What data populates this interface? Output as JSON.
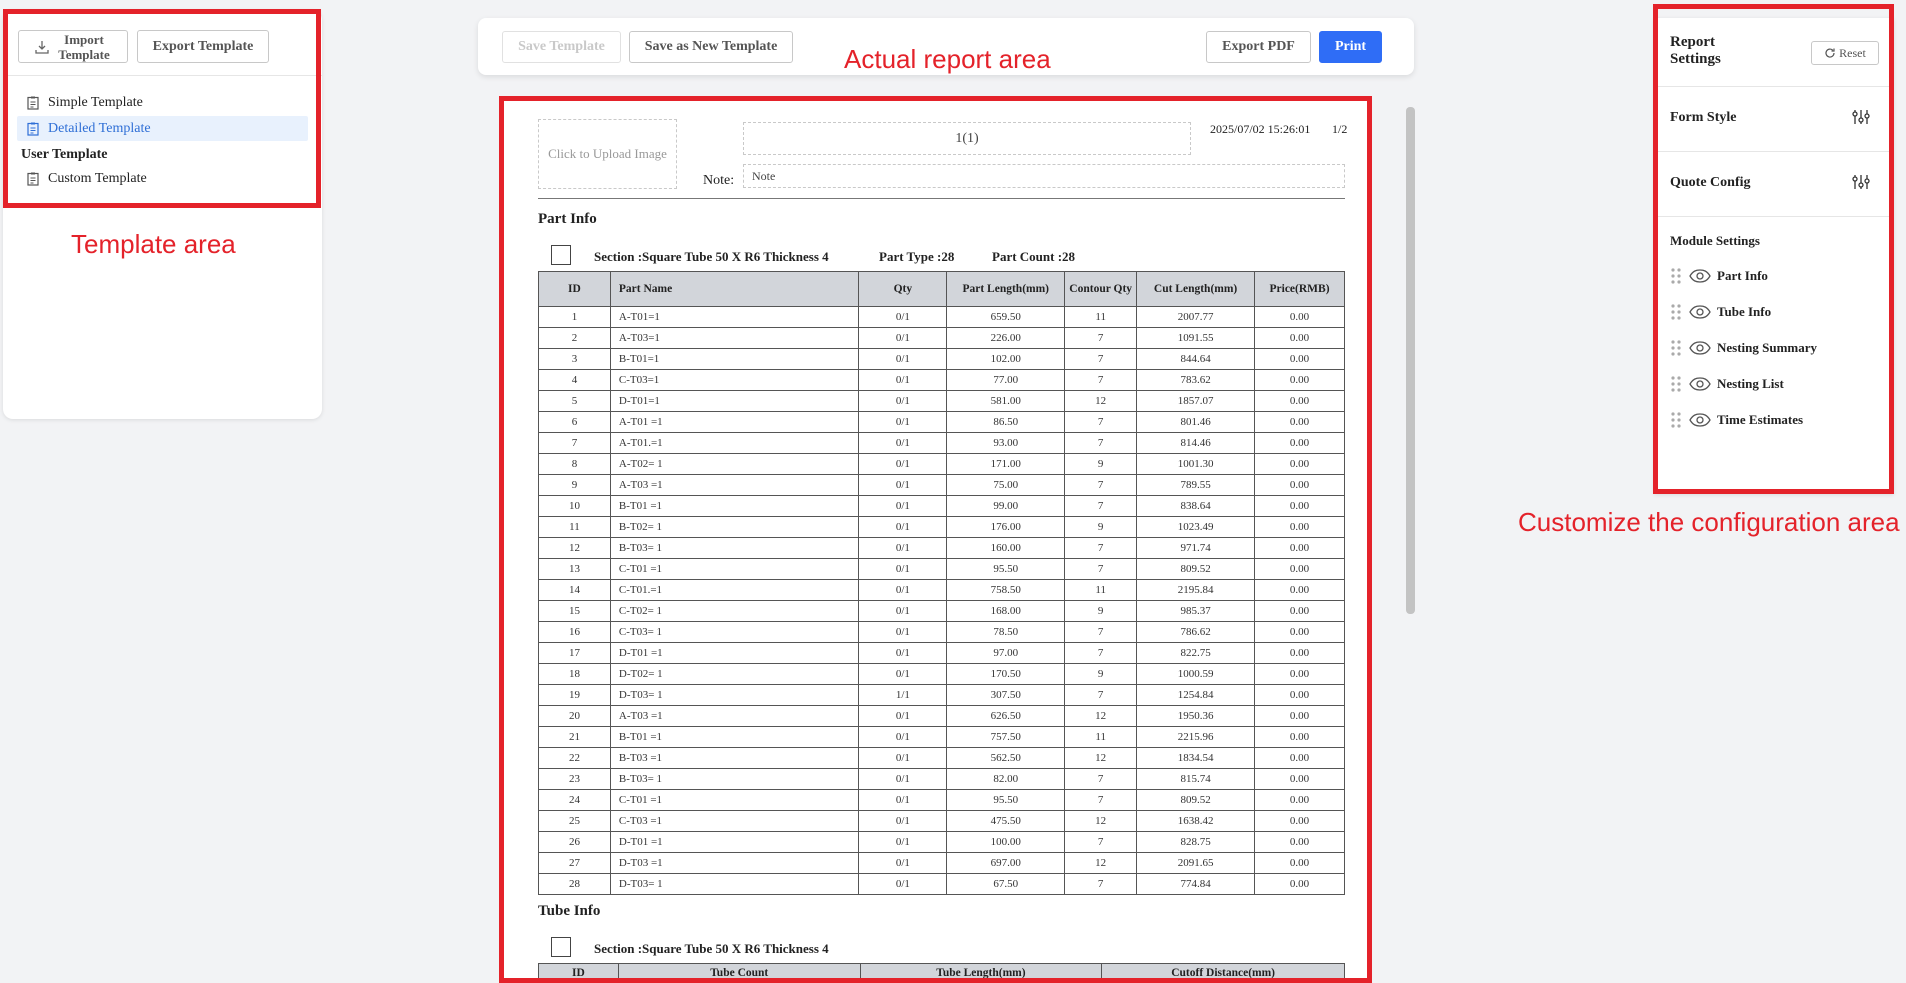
{
  "left": {
    "import_label": "Import Template",
    "export_label": "Export Template",
    "templates": [
      {
        "label": "Simple Template",
        "active": false
      },
      {
        "label": "Detailed Template",
        "active": true
      }
    ],
    "user_group": "User Template",
    "user_templates": [
      {
        "label": "Custom Template"
      }
    ]
  },
  "toolbar": {
    "save_template": "Save Template",
    "save_new": "Save as New Template",
    "export_pdf": "Export PDF",
    "print": "Print"
  },
  "annotations": {
    "template_area": "Template area",
    "report_area": "Actual report area",
    "config_area": "Customize the configuration area"
  },
  "report": {
    "upload": "Click to Upload Image",
    "title": "1(1)",
    "timestamp": "2025/07/02 15:26:01",
    "page": "1/2",
    "note_label": "Note:",
    "note_value": "Note",
    "part_info": {
      "heading": "Part Info",
      "section": "Section :Square Tube 50 X R6 Thickness 4",
      "part_type": "Part Type :28",
      "part_count": "Part Count :28",
      "columns": [
        "ID",
        "Part Name",
        "Qty",
        "Part Length(mm)",
        "Contour Qty",
        "Cut Length(mm)",
        "Price(RMB)"
      ],
      "rows": [
        [
          "1",
          "A-T01=1",
          "0/1",
          "659.50",
          "11",
          "2007.77",
          "0.00"
        ],
        [
          "2",
          "A-T03=1",
          "0/1",
          "226.00",
          "7",
          "1091.55",
          "0.00"
        ],
        [
          "3",
          "B-T01=1",
          "0/1",
          "102.00",
          "7",
          "844.64",
          "0.00"
        ],
        [
          "4",
          "C-T03=1",
          "0/1",
          "77.00",
          "7",
          "783.62",
          "0.00"
        ],
        [
          "5",
          "D-T01=1",
          "0/1",
          "581.00",
          "12",
          "1857.07",
          "0.00"
        ],
        [
          "6",
          "A-T01 =1",
          "0/1",
          "86.50",
          "7",
          "801.46",
          "0.00"
        ],
        [
          "7",
          "A-T01.=1",
          "0/1",
          "93.00",
          "7",
          "814.46",
          "0.00"
        ],
        [
          "8",
          "A-T02= 1",
          "0/1",
          "171.00",
          "9",
          "1001.30",
          "0.00"
        ],
        [
          "9",
          "A-T03 =1",
          "0/1",
          "75.00",
          "7",
          "789.55",
          "0.00"
        ],
        [
          "10",
          "B-T01 =1",
          "0/1",
          "99.00",
          "7",
          "838.64",
          "0.00"
        ],
        [
          "11",
          "B-T02= 1",
          "0/1",
          "176.00",
          "9",
          "1023.49",
          "0.00"
        ],
        [
          "12",
          "B-T03= 1",
          "0/1",
          "160.00",
          "7",
          "971.74",
          "0.00"
        ],
        [
          "13",
          "C-T01 =1",
          "0/1",
          "95.50",
          "7",
          "809.52",
          "0.00"
        ],
        [
          "14",
          "C-T01.=1",
          "0/1",
          "758.50",
          "11",
          "2195.84",
          "0.00"
        ],
        [
          "15",
          "C-T02= 1",
          "0/1",
          "168.00",
          "9",
          "985.37",
          "0.00"
        ],
        [
          "16",
          "C-T03= 1",
          "0/1",
          "78.50",
          "7",
          "786.62",
          "0.00"
        ],
        [
          "17",
          "D-T01 =1",
          "0/1",
          "97.00",
          "7",
          "822.75",
          "0.00"
        ],
        [
          "18",
          "D-T02= 1",
          "0/1",
          "170.50",
          "9",
          "1000.59",
          "0.00"
        ],
        [
          "19",
          "D-T03= 1",
          "1/1",
          "307.50",
          "7",
          "1254.84",
          "0.00"
        ],
        [
          "20",
          "A-T03 =1",
          "0/1",
          "626.50",
          "12",
          "1950.36",
          "0.00"
        ],
        [
          "21",
          "B-T01 =1",
          "0/1",
          "757.50",
          "11",
          "2215.96",
          "0.00"
        ],
        [
          "22",
          "B-T03 =1",
          "0/1",
          "562.50",
          "12",
          "1834.54",
          "0.00"
        ],
        [
          "23",
          "B-T03= 1",
          "0/1",
          "82.00",
          "7",
          "815.74",
          "0.00"
        ],
        [
          "24",
          "C-T01 =1",
          "0/1",
          "95.50",
          "7",
          "809.52",
          "0.00"
        ],
        [
          "25",
          "C-T03 =1",
          "0/1",
          "475.50",
          "12",
          "1638.42",
          "0.00"
        ],
        [
          "26",
          "D-T01 =1",
          "0/1",
          "100.00",
          "7",
          "828.75",
          "0.00"
        ],
        [
          "27",
          "D-T03 =1",
          "0/1",
          "697.00",
          "12",
          "2091.65",
          "0.00"
        ],
        [
          "28",
          "D-T03= 1",
          "0/1",
          "67.50",
          "7",
          "774.84",
          "0.00"
        ]
      ]
    },
    "tube_info": {
      "heading": "Tube Info",
      "section": "Section :Square Tube 50 X R6 Thickness 4",
      "columns": [
        "ID",
        "Tube Count",
        "Tube Length(mm)",
        "Cutoff Distance(mm)"
      ]
    }
  },
  "settings": {
    "title": "Report Settings",
    "reset": "Reset",
    "form_style": "Form Style",
    "quote_config": "Quote Config",
    "module_title": "Module Settings",
    "modules": [
      "Part Info",
      "Tube Info",
      "Nesting Summary",
      "Nesting List",
      "Time Estimates"
    ]
  },
  "colors": {
    "accent": "#2f6df6",
    "annotation": "#e4222a",
    "active_bg": "#e8f1fd"
  }
}
